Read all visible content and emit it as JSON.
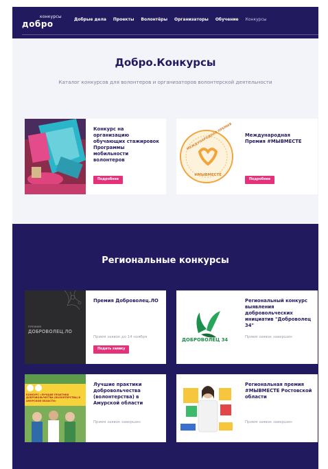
{
  "header": {
    "logo_sup": "конкурсы",
    "logo_main": "добро",
    "nav": [
      {
        "label": "Добрые дела",
        "active": false
      },
      {
        "label": "Проекты",
        "active": false
      },
      {
        "label": "Волонтёры",
        "active": false
      },
      {
        "label": "Организаторы",
        "active": false
      },
      {
        "label": "Обучение",
        "active": false
      },
      {
        "label": "Конкурсы",
        "active": true
      }
    ]
  },
  "hero": {
    "title": "Добро.Конкурсы",
    "subtitle": "Каталог конкурсов для волонтеров и организаторов волонтерской деятельности"
  },
  "featured": [
    {
      "title": "Конкурс на организацию обучающих стажировок Программы мобильности волонтеров",
      "button": "Подробнее"
    },
    {
      "title": "Международная Премия #МЫВМЕСТЕ",
      "button": "Подробнее",
      "badge_top": "МЕЖДУНАРОДНАЯ ПРЕМИЯ",
      "badge_bottom": "#МЫВМЕСТЕ"
    }
  ],
  "regional": {
    "title": "Региональные конкурсы",
    "cards": [
      {
        "title": "Премия Доброволец.ЛО",
        "meta": "Прием заявок до 14 ноября",
        "button": "Подать заявку",
        "thumb_small": "ПРЕМИЯ",
        "thumb_big": "ДОБРОВОЛЕЦ.ЛО"
      },
      {
        "title": "Региональный конкурс выявления добровольческих инициатив \"Доброволец 34\"",
        "meta": "Прием заявок завершен",
        "thumb_logo": "ДОБРОВОЛЕЦ 34"
      },
      {
        "title": "Лучшие практики добровольчества (волонтерства) в Амурской области",
        "meta": "Прием заявок завершен",
        "thumb_band": "КОНКУРС «ЛУЧШИЕ ПРАКТИКИ ДОБРОВОЛЬЧЕСТВА (ВОЛОНТЕРСТВА) В АМУРСКОЙ ОБЛАСТИ»"
      },
      {
        "title": "Региональная премия #МЫВМЕСТЕ Ростовской области",
        "meta": "Прием заявок завершен"
      }
    ]
  },
  "colors": {
    "navy": "#221a5e",
    "accent": "#e5317a",
    "hero_bg": "#f2f4fa"
  }
}
